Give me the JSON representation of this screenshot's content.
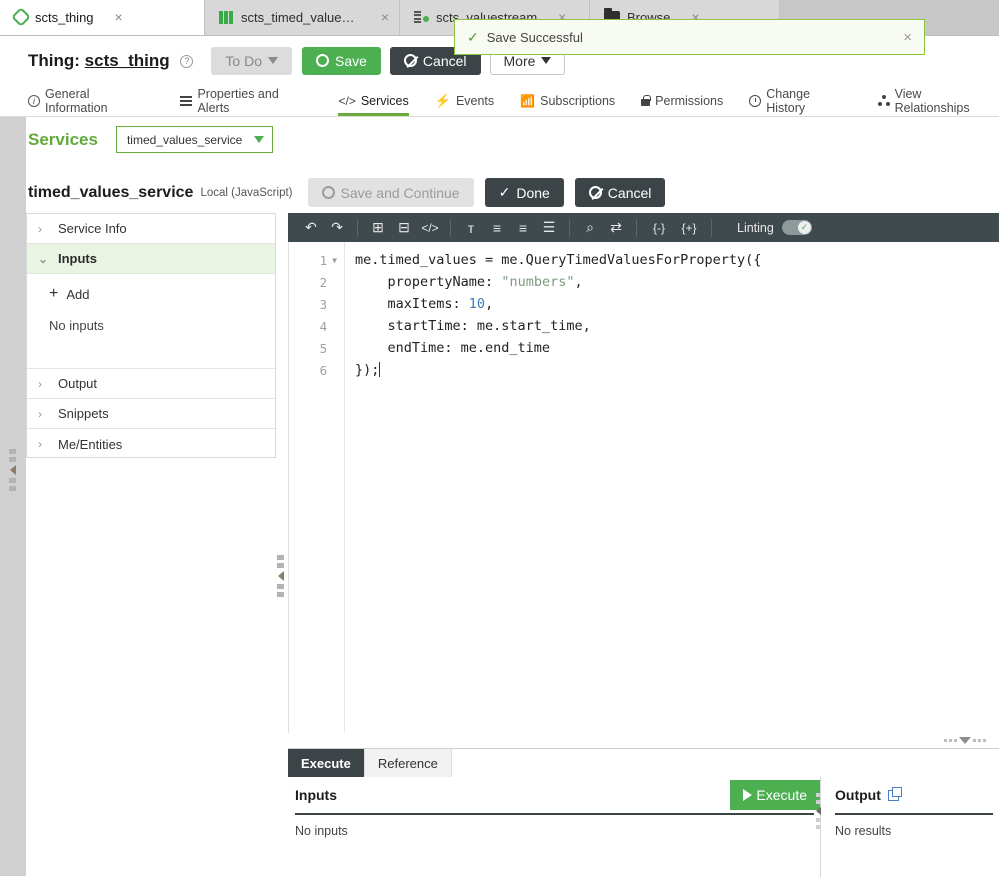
{
  "browser_tabs": [
    {
      "label": "scts_thing",
      "icon": "thing-icon",
      "active": true,
      "close": "×"
    },
    {
      "label": "scts_timed_values_datas…",
      "icon": "datashape-icon",
      "active": false,
      "close": "×"
    },
    {
      "label": "scts_valuestream",
      "icon": "valuestream-icon",
      "active": false,
      "close": "×"
    },
    {
      "label": "Browse",
      "icon": "folder-icon",
      "active": false,
      "close": "×"
    }
  ],
  "toast": {
    "message": "Save Successful",
    "check": "✓",
    "close": "×",
    "border_color": "#8cc63f",
    "background": "#f7fbf2"
  },
  "entity_header": {
    "prefix": "Thing:",
    "name": "scts_thing",
    "help": "?",
    "todo_label": "To Do",
    "save_label": "Save",
    "cancel_label": "Cancel",
    "more_label": "More",
    "save_color": "#4caf50",
    "cancel_color": "#3c4448"
  },
  "subnav": [
    {
      "label": "General Information",
      "icon": "info-icon",
      "active": false
    },
    {
      "label": "Properties and Alerts",
      "icon": "list-icon",
      "active": false
    },
    {
      "label": "Services",
      "icon": "code-icon",
      "active": true
    },
    {
      "label": "Events",
      "icon": "bolt-icon",
      "active": false
    },
    {
      "label": "Subscriptions",
      "icon": "rss-icon",
      "active": false
    },
    {
      "label": "Permissions",
      "icon": "lock-icon",
      "active": false
    },
    {
      "label": "Change History",
      "icon": "clock-icon",
      "active": false
    },
    {
      "label": "View Relationships",
      "icon": "relationships-icon",
      "active": false
    }
  ],
  "services_bar": {
    "label": "Services",
    "selected_service": "timed_values_service",
    "accent": "#61a93b"
  },
  "service_header": {
    "name": "timed_values_service",
    "meta": "Local (JavaScript)",
    "save_continue_label": "Save and Continue",
    "done_label": "Done",
    "cancel_label": "Cancel"
  },
  "sidebar": {
    "sections": [
      {
        "label": "Service Info",
        "expanded": false
      },
      {
        "label": "Inputs",
        "expanded": true
      },
      {
        "label": "Output",
        "expanded": false
      },
      {
        "label": "Snippets",
        "expanded": false
      },
      {
        "label": "Me/Entities",
        "expanded": false
      }
    ],
    "inputs_body": {
      "add_label": "Add",
      "empty_label": "No inputs"
    }
  },
  "editor_toolbar": {
    "buttons": [
      {
        "name": "undo-icon",
        "glyph": "↶"
      },
      {
        "name": "redo-icon",
        "glyph": "↷"
      },
      {
        "name": "add-comment-icon",
        "glyph": "⊞"
      },
      {
        "name": "remove-comment-icon",
        "glyph": "⊟"
      },
      {
        "name": "code-tag-icon",
        "glyph": "</>"
      },
      {
        "name": "font-size-icon",
        "glyph": "ᴛ"
      },
      {
        "name": "outdent-icon",
        "glyph": "≡"
      },
      {
        "name": "indent-icon",
        "glyph": "≡"
      },
      {
        "name": "format-icon",
        "glyph": "☰"
      },
      {
        "name": "search-icon",
        "glyph": "⌕"
      },
      {
        "name": "replace-icon",
        "glyph": "⇄"
      },
      {
        "name": "collapse-braces-icon",
        "glyph": "{-}"
      },
      {
        "name": "expand-braces-icon",
        "glyph": "{+}"
      }
    ],
    "linting_label": "Linting",
    "linting_on": true,
    "background": "#3e4a4d"
  },
  "code": {
    "lines": [
      {
        "n": "1",
        "foldable": true,
        "text": "me.timed_values = me.QueryTimedValuesForProperty({"
      },
      {
        "n": "2",
        "foldable": false,
        "text": "    propertyName: \"numbers\","
      },
      {
        "n": "3",
        "foldable": false,
        "text": "    maxItems: 10,"
      },
      {
        "n": "4",
        "foldable": false,
        "text": "    startTime: me.start_time,"
      },
      {
        "n": "5",
        "foldable": false,
        "text": "    endTime: me.end_time"
      },
      {
        "n": "6",
        "foldable": false,
        "text": "});"
      }
    ]
  },
  "bottom_panel": {
    "tabs": [
      {
        "label": "Execute",
        "active": true
      },
      {
        "label": "Reference",
        "active": false
      }
    ],
    "inputs": {
      "title": "Inputs",
      "empty": "No inputs",
      "execute_label": "Execute"
    },
    "output": {
      "title": "Output",
      "empty": "No results",
      "popout": "popout-icon"
    }
  }
}
